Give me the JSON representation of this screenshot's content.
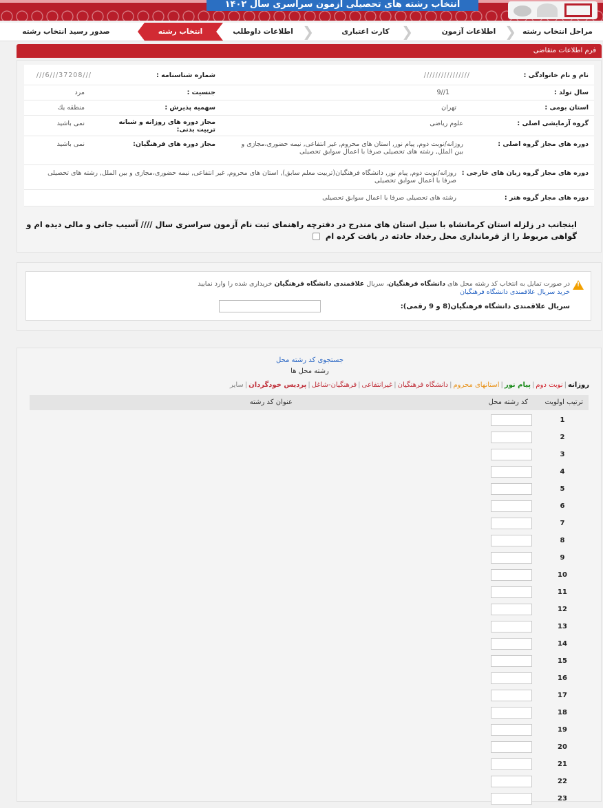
{
  "banner": {
    "title": "انتخاب رشته های تحصیلی آزمون سراسری سال ۱۴۰۲"
  },
  "steps": [
    {
      "label": "مراحل انتخاب رشته",
      "active": false
    },
    {
      "label": "اطلاعات آزمون",
      "active": false
    },
    {
      "label": "کارت اعتباری",
      "active": false
    },
    {
      "label": "اطلاعات داوطلب",
      "active": false
    },
    {
      "label": "انتخاب رشته",
      "active": true
    },
    {
      "label": "صدور رسید انتخاب رشته",
      "active": false
    }
  ],
  "form": {
    "header": "فرم اطلاعات متقاضی",
    "rows": [
      {
        "label": "نام و نام خانوادگی :",
        "value": "////////////////",
        "label2": "شماره شناسنامه :",
        "value2": "///37208///6///"
      },
      {
        "label": "سال تولد :",
        "value": "1//9",
        "label2": "جنسیت :",
        "value2": "مرد"
      },
      {
        "label": "استان بومی :",
        "value": "تهران",
        "label2": "سهمیه پذیرش :",
        "value2": "منطقه یك"
      },
      {
        "label": "گروه آزمایشی اصلی :",
        "value": "علوم ریاضی",
        "label2": "مجاز دوره های روزانه و شبانه تربیت بدنی:",
        "value2": "نمی باشید"
      },
      {
        "label": "دوره های مجاز گروه اصلی :",
        "value": "روزانه/نوبت دوم, پیام نور, استان های محروم, غیر انتفاعی, نیمه حضوری،مجازی و بین الملل, رشته های تحصیلی صرفا با اعمال سوابق تحصیلی",
        "label2": "مجاز دوره های فرهنگیان:",
        "value2": "نمی باشید"
      },
      {
        "label": "دوره های مجاز گروه زبان های خارجی :",
        "value": "روزانه/نوبت دوم, پیام نور, دانشگاه فرهنگیان(تربیت معلم سابق), استان های محروم, غیر انتفاعی, نیمه حضوری،مجازی و بین الملل, رشته های تحصیلی صرفا با اعمال سوابق تحصیلی"
      },
      {
        "label": "دوره های مجاز گروه هنر :",
        "value": "رشته های تحصیلی صرفا با اعمال سوابق تحصیلی"
      }
    ],
    "notice": "اینجانب در زلزله استان کرمانشاه با سیل استان های مندرج در دفترچه راهنمای ثبت نام آزمون سراسری سال //// آسیب جانی و مالی دیده ام و گواهی مربوط را از فرمانداری محل رخداد حادثه در یافت کرده ام"
  },
  "interest": {
    "text_prefix": "در صورت تمایل به انتخاب کد رشته محل های",
    "uni": "دانشگاه فرهنگیان",
    "text_mid": "، سریال",
    "bold2": "علاقمندی دانشگاه فرهنگیان",
    "text_suffix": "خریداری شده را وارد نمایید",
    "link": "خرید سریال علاقمندی دانشگاه فرهنگیان",
    "input_label": "سریال علاقمندی دانشگاه فرهنگیان(8 و 9 رقمی):"
  },
  "selection": {
    "search_link": "جستجوی کد رشته محل",
    "subtitle": "رشته محل ها",
    "filters": [
      {
        "label": "روزانه",
        "color": "#111111",
        "bold": true
      },
      {
        "label": "نوبت دوم",
        "color": "#d0202a",
        "bold": false
      },
      {
        "label": "پیام نور",
        "color": "#1a8a1a",
        "bold": true
      },
      {
        "label": "استانهای محروم",
        "color": "#e8921a",
        "bold": false
      },
      {
        "label": "دانشگاه فرهنگیان",
        "color": "#c0303a",
        "bold": false
      },
      {
        "label": "غیرانتفاعی",
        "color": "#c0303a",
        "bold": false
      },
      {
        "label": "فرهنگیان-شاغل",
        "color": "#c0303a",
        "bold": false
      },
      {
        "label": "پردیس خودگردان",
        "color": "#c0303a",
        "bold": false
      },
      {
        "label": "سایر",
        "color": "#888888",
        "bold": false
      }
    ],
    "columns": {
      "priority": "ترتیب اولویت",
      "code": "کد رشته محل",
      "title": "عنوان کد رشته"
    },
    "rows": [
      "1",
      "2",
      "3",
      "4",
      "5",
      "6",
      "7",
      "8",
      "9",
      "10",
      "11",
      "12",
      "13",
      "14",
      "15",
      "16",
      "17",
      "18",
      "19",
      "20",
      "21",
      "22",
      "23"
    ]
  }
}
